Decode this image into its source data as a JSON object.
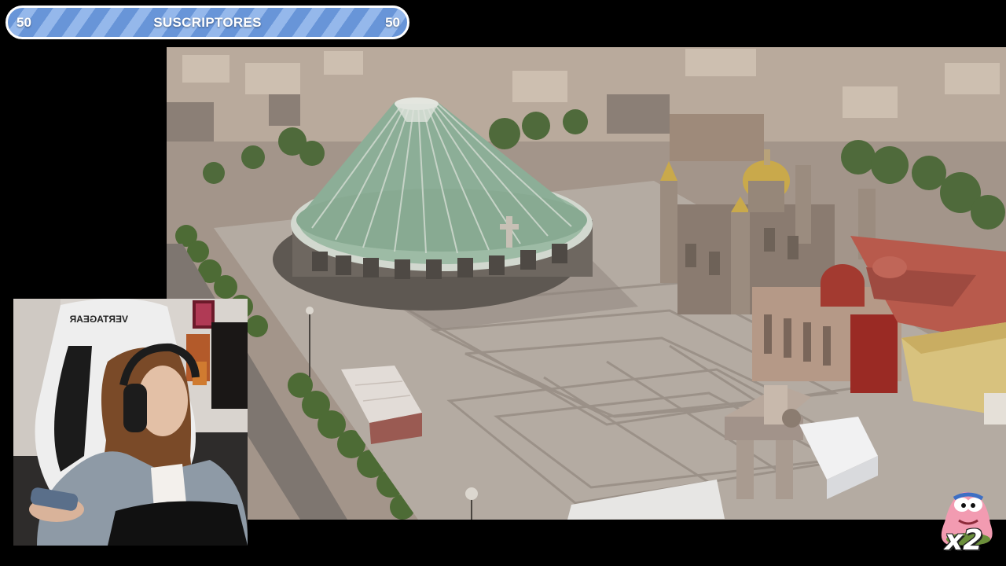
{
  "subscriber_goal": {
    "current": "50",
    "label": "SUSCRIPTORES",
    "target": "50",
    "progress_fraction": 1.0,
    "stripe_color": "#5f8fd6",
    "stripe_light_color": "#8fb4ea",
    "border_color": "#ffffff"
  },
  "video": {
    "icon": "aerial-basilica-scene"
  },
  "webcam": {
    "chair_brand": "VERTAGEAR",
    "icon": "streamer-webcam"
  },
  "sticker": {
    "icon": "patrick-star-emote",
    "multiplier": "x2"
  }
}
